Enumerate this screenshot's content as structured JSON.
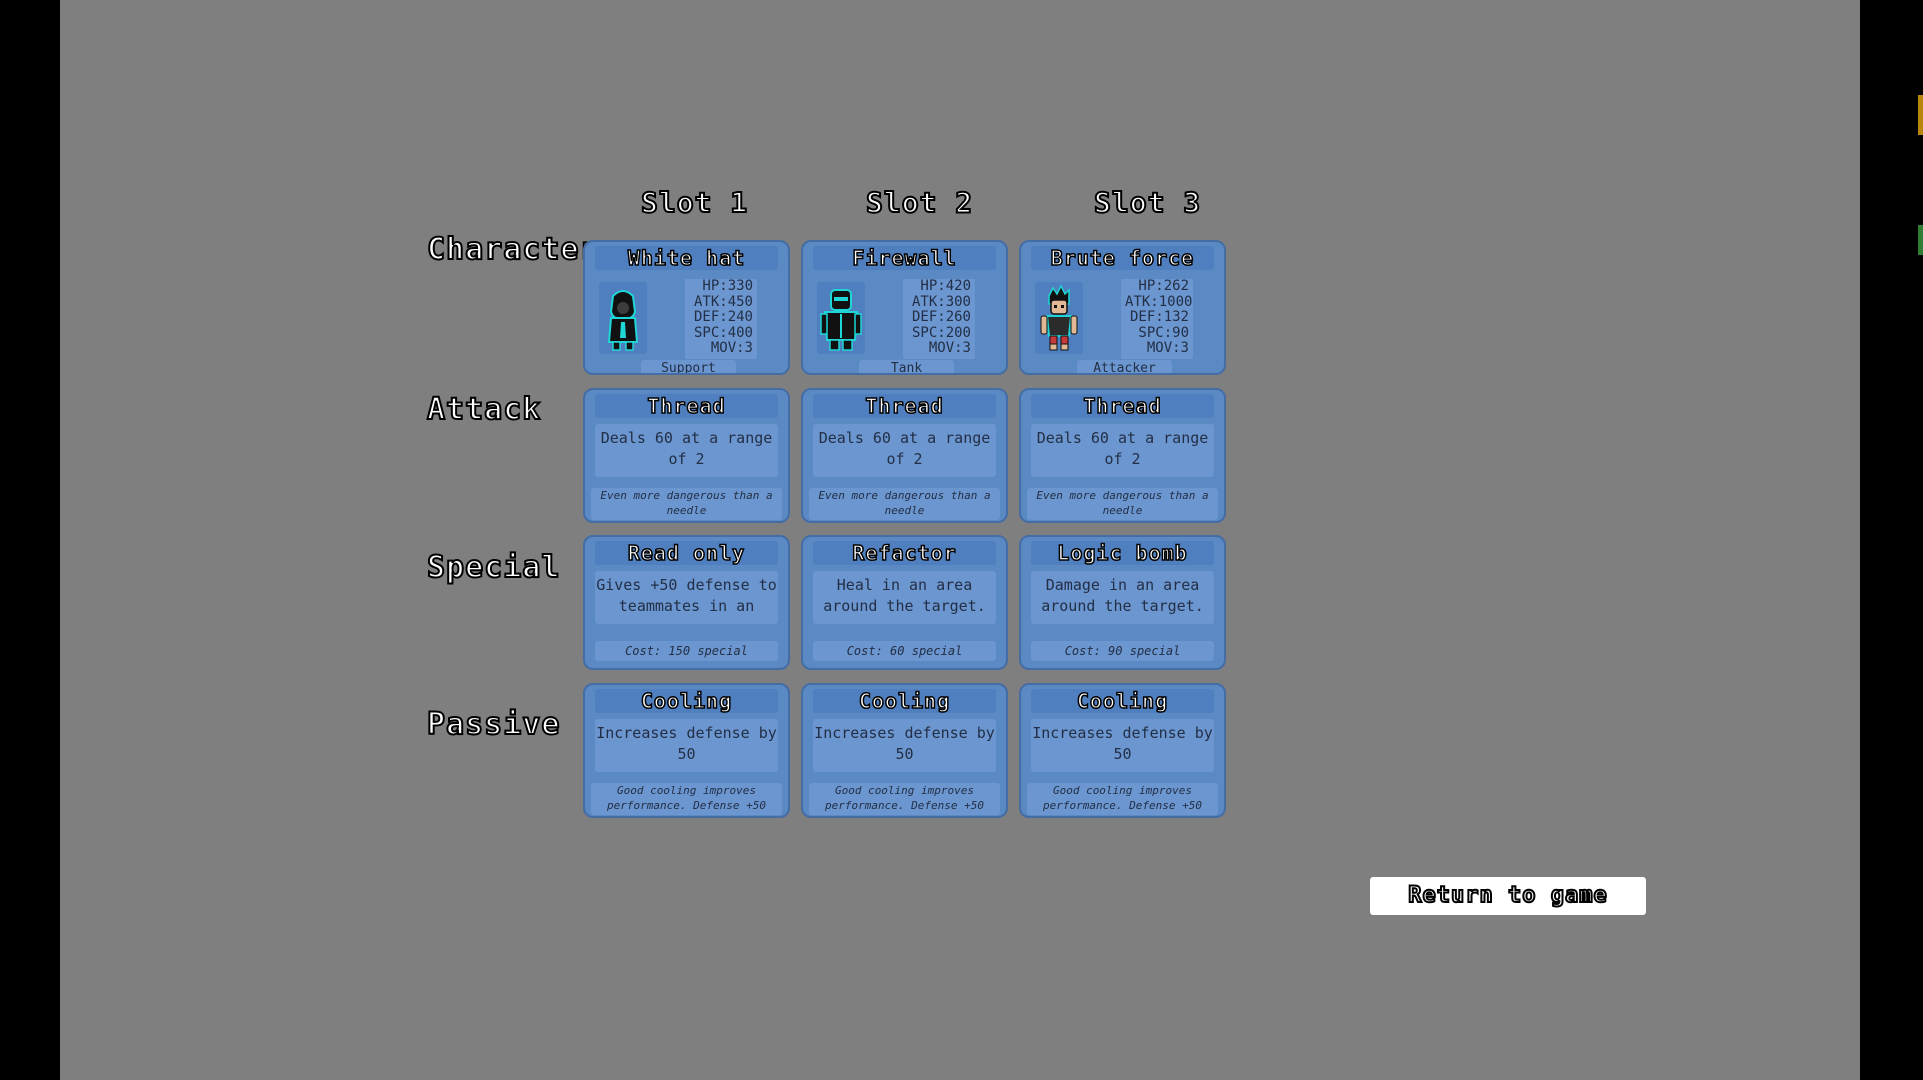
{
  "slots": [
    "Slot 1",
    "Slot 2",
    "Slot 3"
  ],
  "row_labels": {
    "character": "Character",
    "attack": "Attack",
    "special": "Special",
    "passive": "Passive"
  },
  "characters": [
    {
      "name": "White hat",
      "stats": [
        "HP:330",
        "ATK:450",
        "DEF:240",
        "SPC:400",
        "MOV:3"
      ],
      "role": "Support",
      "portrait_icon": "hooded-hacker-icon"
    },
    {
      "name": "Firewall",
      "stats": [
        "HP:420",
        "ATK:300",
        "DEF:260",
        "SPC:200",
        "MOV:3"
      ],
      "role": "Tank",
      "portrait_icon": "armored-tank-icon"
    },
    {
      "name": "Brute force",
      "stats": [
        "HP:262",
        "ATK:1000",
        "DEF:132",
        "SPC:90",
        "MOV:3"
      ],
      "role": "Attacker",
      "portrait_icon": "brawler-icon"
    }
  ],
  "attacks": [
    {
      "name": "Thread",
      "desc": "Deals 60 at a range of 2",
      "flavor": "Even more dangerous than a needle"
    },
    {
      "name": "Thread",
      "desc": "Deals 60 at a range of 2",
      "flavor": "Even more dangerous than a needle"
    },
    {
      "name": "Thread",
      "desc": "Deals 60 at a range of 2",
      "flavor": "Even more dangerous than a needle"
    }
  ],
  "specials": [
    {
      "name": "Read only",
      "desc": "Gives +50 defense to teammates in an",
      "cost": "Cost: 150 special"
    },
    {
      "name": "Refactor",
      "desc": "Heal in an area around the target.",
      "cost": "Cost: 60 special"
    },
    {
      "name": "Logic bomb",
      "desc": "Damage in an area around the target.",
      "cost": "Cost: 90 special"
    }
  ],
  "passives": [
    {
      "name": "Cooling",
      "desc": "Increases defense by 50",
      "flavor": "Good cooling improves performance. Defense +50"
    },
    {
      "name": "Cooling",
      "desc": "Increases defense by 50",
      "flavor": "Good cooling improves performance. Defense +50"
    },
    {
      "name": "Cooling",
      "desc": "Increases defense by 50",
      "flavor": "Good cooling improves performance. Defense +50"
    }
  ],
  "return_button": "Return to game",
  "colors": {
    "background": "#7f7f7f",
    "letterbox": "#000000",
    "card": "#5a89c4",
    "card_inner": "#6b96cf",
    "text_dark": "#232f46",
    "sprite_outline": "#1fd6d6"
  }
}
